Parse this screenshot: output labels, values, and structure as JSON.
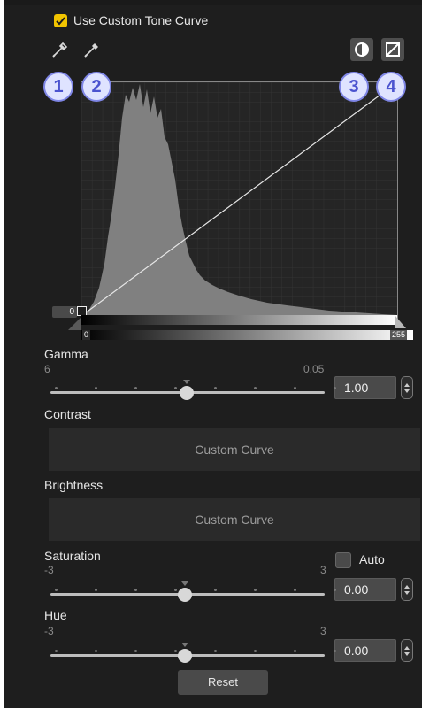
{
  "header": {
    "checkbox_label": "Use Custom Tone Curve",
    "checked": true
  },
  "tools": {
    "eyedropper1_icon": "eyedropper-black-point-icon",
    "eyedropper2_icon": "eyedropper-white-point-icon",
    "contrast_icon": "contrast-toggle-icon",
    "linear_icon": "linear-curve-reset-icon"
  },
  "callouts": [
    "1",
    "2",
    "3",
    "4"
  ],
  "graph": {
    "input_low": "0",
    "gradient_low": "0",
    "gradient_high": "255"
  },
  "gamma": {
    "label": "Gamma",
    "min_label": "6",
    "max_label": "0.05",
    "value": "1.00",
    "position": 0.5
  },
  "contrast": {
    "label": "Contrast",
    "button_text": "Custom Curve"
  },
  "brightness": {
    "label": "Brightness",
    "button_text": "Custom Curve"
  },
  "saturation": {
    "label": "Saturation",
    "min_label": "-3",
    "max_label": "3",
    "value": "0.00",
    "auto_label": "Auto",
    "auto_checked": false,
    "position": 0.5
  },
  "hue": {
    "label": "Hue",
    "min_label": "-3",
    "max_label": "3",
    "value": "0.00",
    "position": 0.5
  },
  "reset_label": "Reset",
  "colors": {
    "panel_bg": "#1e1e1e",
    "accent_yellow": "#f2c400",
    "callout_fill": "#dfe3ff",
    "callout_text": "#4b53cf"
  }
}
